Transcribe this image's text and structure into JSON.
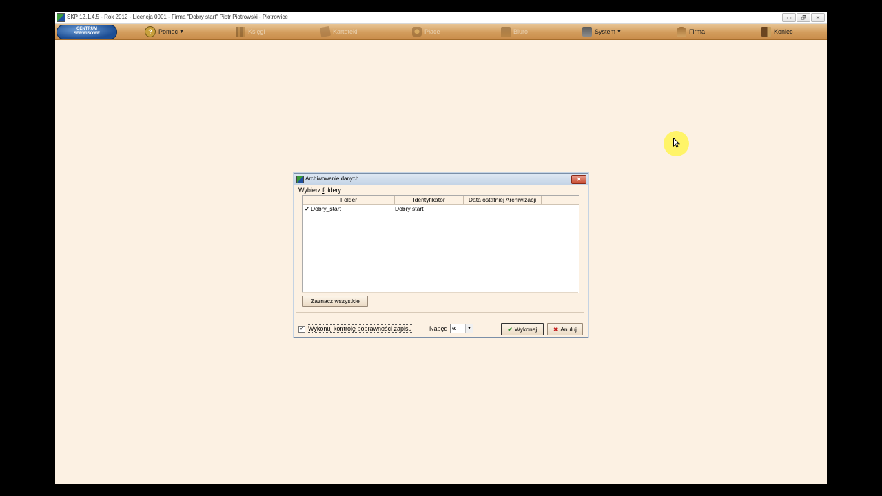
{
  "window": {
    "title": "SKP 12.1.4.5 - Rok 2012 - Licencja 0001 - Firma \"Dobry start\" Piotr Piotrowski - Piotrowice",
    "minimize": "▭",
    "restore": "🗗",
    "close": "✕"
  },
  "logo": {
    "line1": "CENTRUM",
    "line2": "SERWISOWE"
  },
  "menu": {
    "items": [
      {
        "label": "Pomoc",
        "icon": "help-icon",
        "enabled": true,
        "dropdown": true
      },
      {
        "label": "Księgi",
        "icon": "books-icon",
        "enabled": false
      },
      {
        "label": "Kartoteki",
        "icon": "cards-icon",
        "enabled": false
      },
      {
        "label": "Płace",
        "icon": "payroll-icon",
        "enabled": false
      },
      {
        "label": "Biuro",
        "icon": "office-icon",
        "enabled": false
      },
      {
        "label": "System",
        "icon": "system-icon",
        "enabled": true,
        "dropdown": true
      },
      {
        "label": "Firma",
        "icon": "firm-icon",
        "enabled": true
      },
      {
        "label": "Koniec",
        "icon": "exit-icon",
        "enabled": true
      }
    ]
  },
  "dialog": {
    "title": "Archiwowanie danych",
    "close": "✕",
    "folders_label_pre": "Wybierz ",
    "folders_label_key": "f",
    "folders_label_post": "oldery",
    "columns": [
      "Folder",
      "Identyfikator",
      "Data ostatniej Archiwizacji"
    ],
    "rows": [
      {
        "checked": true,
        "folder": "Dobry_start",
        "identifier": "Dobry start",
        "last_archive": ""
      }
    ],
    "select_all": "Zaznacz wszystkie",
    "verify_label": "Wykonuj kontrolę poprawności zapisu",
    "verify_checked": true,
    "drive_label": "Napęd",
    "drive_value": "e:",
    "ok": "Wykonaj",
    "cancel": "Anuluj"
  }
}
